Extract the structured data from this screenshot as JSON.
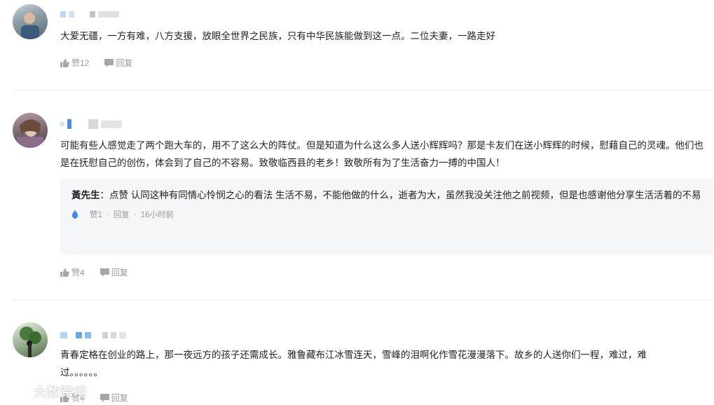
{
  "comments": [
    {
      "text": "大爱无疆，一方有难，八方支援，放眼全世界之民族，只有中华民族能做到这一点。二位夫妻，一路走好",
      "like_label": "赞12",
      "reply_label": "回复"
    },
    {
      "text": "可能有些人感觉走了两个跑大车的，用不了这么大的阵仗。但是知道为什么这么多人送小辉辉吗？那是卡友们在送小辉辉的时候，慰藉自己的灵魂。他们也是在抚慰自己的创伤，体会到了自己的不容易。致敬临西县的老乡！致敬所有为了生活奋力一搏的中国人！",
      "like_label": "赞4",
      "reply_label": "回复",
      "reply": {
        "author": "黃先生",
        "separator": "：",
        "text": "点赞 认同这种有同情心怜悯之心的看法 生活不易，不能他做的什么，逝者为大，虽然我没关注他之前视频，但是也感谢他分享生活活着的不易",
        "likes": "赞1",
        "reply_label": "回复",
        "time": "16小时前",
        "dot": "·"
      }
    },
    {
      "text": "青春定格在创业的路上，那一夜远方的孩子还需成长。雅鲁藏布江冰雪连天，雪峰的泪啊化作雪花漫漫落下。故乡的人送你们一程，难过，难过。。。。。。",
      "like_label": "赞4",
      "reply_label": "回复"
    }
  ],
  "watermark": "大数跨境",
  "colors": {
    "meta": "#999999",
    "accent_drop": "#3b8ee8",
    "reply_bg": "#f5f6f7",
    "divider": "#eeeeee"
  }
}
